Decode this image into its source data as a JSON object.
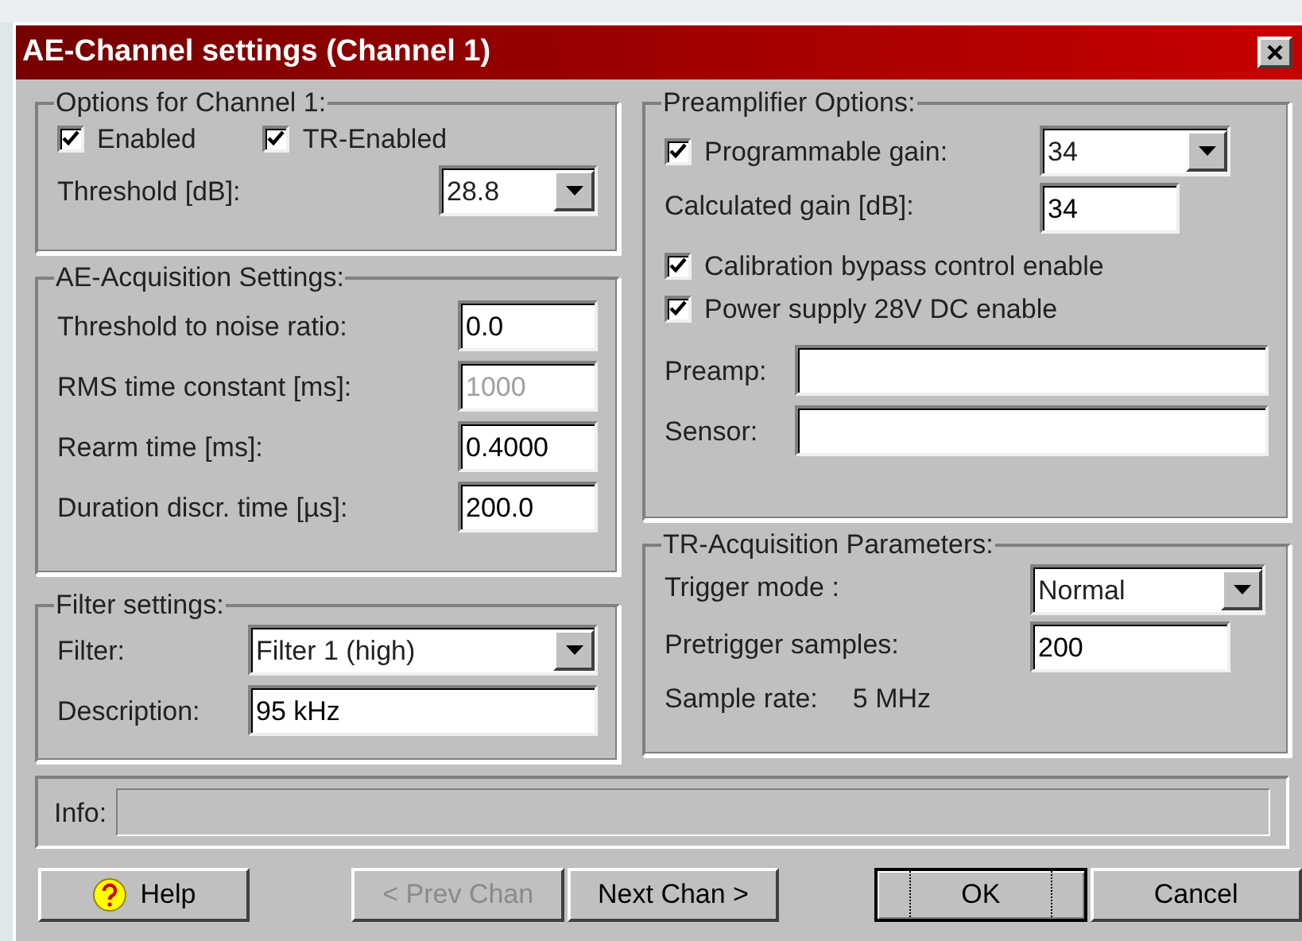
{
  "window": {
    "title": "AE-Channel settings (Channel 1)"
  },
  "options": {
    "title": "Options for Channel 1:",
    "checkboxes": [
      {
        "label": "Enabled",
        "checked": true
      },
      {
        "label": "TR-Enabled",
        "checked": true
      }
    ],
    "threshold": {
      "label": "Threshold [dB]:",
      "value": "28.8"
    }
  },
  "acquisition": {
    "title": "AE-Acquisition Settings:",
    "fields": [
      {
        "label": "Threshold to noise ratio:",
        "value": "0.0",
        "disabled": false
      },
      {
        "label": "RMS time constant [ms]:",
        "value": "1000",
        "disabled": true
      },
      {
        "label": "Rearm time [ms]:",
        "value": "0.4000",
        "disabled": false
      },
      {
        "label": "Duration discr. time [µs]:",
        "value": "200.0",
        "disabled": false
      }
    ]
  },
  "filter": {
    "title": "Filter settings:",
    "filter": {
      "label": "Filter:",
      "value": "Filter 1 (high)"
    },
    "description": {
      "label": "Description:",
      "value": "95 kHz"
    }
  },
  "preamplifier": {
    "title": "Preamplifier Options:",
    "gain": {
      "label": "Programmable gain:",
      "checked": true,
      "value": "34"
    },
    "calculated": {
      "label": "Calculated gain [dB]:",
      "value": "34"
    },
    "checkboxes": [
      {
        "label": "Calibration bypass control enable",
        "checked": true
      },
      {
        "label": "Power supply 28V DC enable",
        "checked": true
      }
    ],
    "fields": [
      {
        "label": "Preamp:"
      },
      {
        "label": "Sensor:"
      }
    ]
  },
  "tr": {
    "title": "TR-Acquisition Parameters:",
    "trigger": {
      "label": "Trigger mode :",
      "value": "Normal"
    },
    "pretrigger": {
      "label": "Pretrigger samples:",
      "value": "200"
    },
    "sample_rate": {
      "label": "Sample rate:",
      "value": "5 MHz"
    }
  },
  "info": {
    "label": "Info:"
  },
  "buttons": [
    {
      "label": "Help",
      "kind": "help",
      "disabled": false,
      "default": false
    },
    {
      "label": "< Prev Chan",
      "kind": "plain",
      "disabled": true,
      "default": false
    },
    {
      "label": "Next Chan >",
      "kind": "plain",
      "disabled": false,
      "default": false
    },
    {
      "label": "OK",
      "kind": "plain",
      "disabled": false,
      "default": true
    },
    {
      "label": "Cancel",
      "kind": "plain",
      "disabled": false,
      "default": false
    }
  ]
}
